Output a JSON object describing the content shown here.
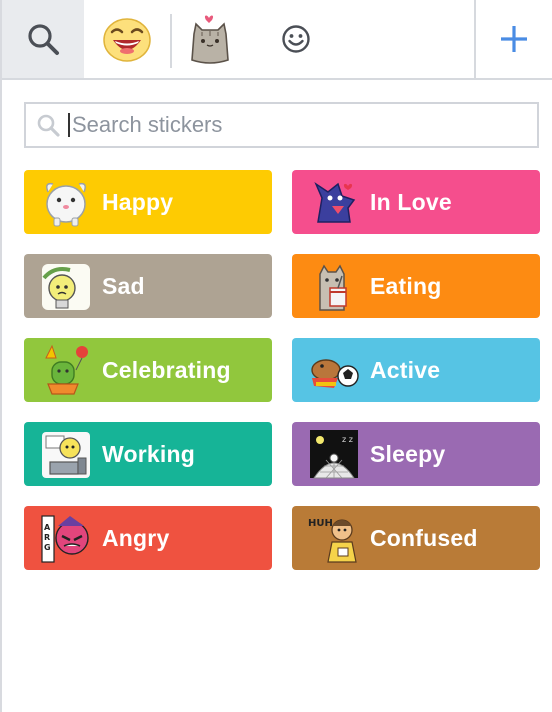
{
  "tabs": {
    "search_icon": "magnifier-icon",
    "emoji_icon": "laughing-face-icon",
    "pusheen_icon": "pusheen-cat-icon",
    "smiley_icon": "smiley-icon",
    "add_icon": "plus-icon",
    "accent": "#4a8ce4"
  },
  "search": {
    "placeholder": "Search stickers",
    "value": ""
  },
  "categories": [
    {
      "label": "Happy",
      "color": "#fecb02",
      "icon": "white-creature-sticker"
    },
    {
      "label": "In Love",
      "color": "#f54e8d",
      "icon": "dragon-dog-sticker"
    },
    {
      "label": "Sad",
      "color": "#aea393",
      "icon": "sad-lamp-sticker"
    },
    {
      "label": "Eating",
      "color": "#fd8b12",
      "icon": "pusheen-eating-sticker"
    },
    {
      "label": "Celebrating",
      "color": "#91c73d",
      "icon": "cactus-party-sticker"
    },
    {
      "label": "Active",
      "color": "#56c4e4",
      "icon": "dog-soccer-sticker"
    },
    {
      "label": "Working",
      "color": "#16b497",
      "icon": "desk-worker-sticker"
    },
    {
      "label": "Sleepy",
      "color": "#9a6ab2",
      "icon": "night-sky-sticker"
    },
    {
      "label": "Angry",
      "color": "#ef5240",
      "icon": "angry-hero-sticker"
    },
    {
      "label": "Confused",
      "color": "#b97b37",
      "icon": "huh-guy-sticker"
    }
  ]
}
